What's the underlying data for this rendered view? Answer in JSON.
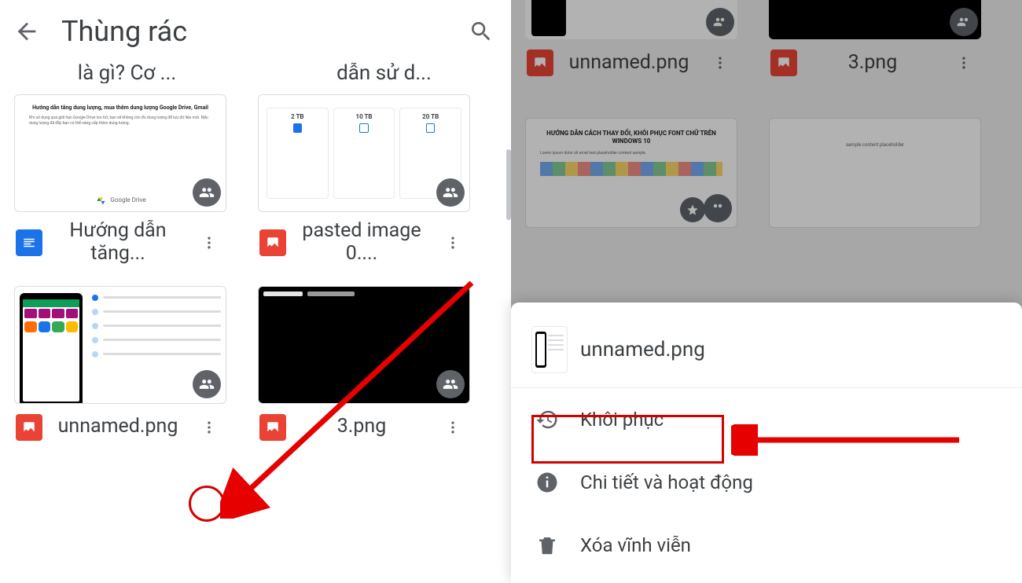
{
  "left": {
    "title": "Thùng rác",
    "cut_left": "là gì? Cơ ...",
    "cut_right": "dẫn sử d...",
    "files": [
      {
        "name": "Hướng dẫn tăng...",
        "type": "doc"
      },
      {
        "name": "pasted image 0....",
        "type": "image"
      },
      {
        "name": "unnamed.png",
        "type": "image"
      },
      {
        "name": "3.png",
        "type": "image"
      }
    ],
    "doc_thumb": {
      "title": "Hướng dẫn tăng dung lượng, mua thêm dung lượng Google Drive, Gmail",
      "body": "Khi sử dụng quá giới hạn Google Drive lưu trữ, bạn sẽ không còn đủ dung lượng để lưu dữ liệu mới. Nếu dung lượng đã đầy bạn có thể nâng cấp thêm dung lượng.",
      "brand": "Google Drive"
    },
    "plans": [
      "2 TB",
      "10 TB",
      "20 TB"
    ]
  },
  "right": {
    "files_top": [
      {
        "name": "unnamed.png",
        "type": "image"
      },
      {
        "name": "3.png",
        "type": "image"
      }
    ],
    "thumb2_title": "HƯỚNG DẪN CÁCH THAY ĐỔI, KHÔI PHỤC FONT CHỮ TRÊN WINDOWS 10",
    "sheet": {
      "filename": "unnamed.png",
      "items": [
        {
          "icon": "restore",
          "label": "Khôi phục"
        },
        {
          "icon": "info",
          "label": "Chi tiết và hoạt động"
        },
        {
          "icon": "delete",
          "label": "Xóa vĩnh viễn"
        }
      ]
    }
  }
}
